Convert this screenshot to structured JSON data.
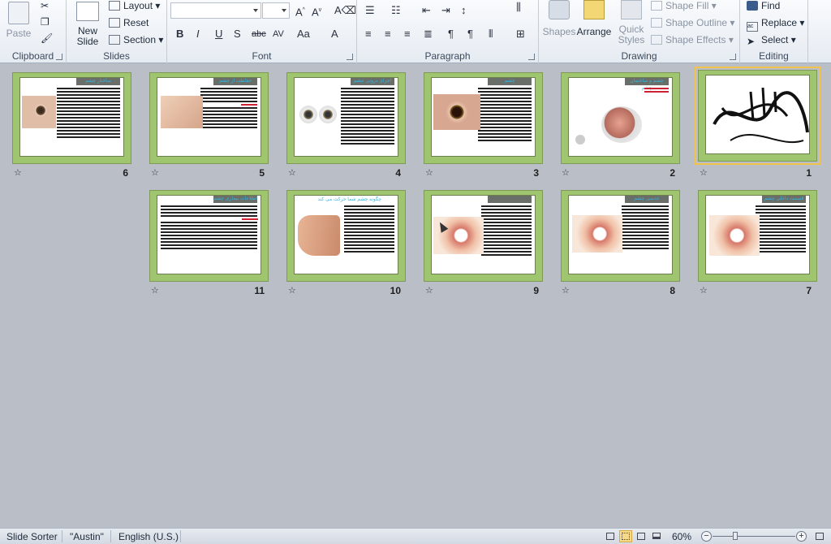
{
  "ribbon": {
    "clipboard": {
      "label": "Clipboard",
      "paste": "Paste"
    },
    "slides": {
      "label": "Slides",
      "new_slide": "New Slide",
      "layout": "Layout",
      "reset": "Reset",
      "section": "Section"
    },
    "font": {
      "label": "Font",
      "font_name": "",
      "font_size": ""
    },
    "paragraph": {
      "label": "Paragraph"
    },
    "drawing": {
      "label": "Drawing",
      "shapes": "Shapes",
      "arrange": "Arrange",
      "quick_styles": "Quick Styles",
      "shape_fill": "Shape Fill",
      "shape_outline": "Shape Outline",
      "shape_effects": "Shape Effects"
    },
    "editing": {
      "label": "Editing",
      "find": "Find",
      "replace": "Replace",
      "select": "Select"
    }
  },
  "slides": [
    {
      "number": "1",
      "title": "",
      "kind": "calligraphy",
      "selected": true
    },
    {
      "number": "2",
      "title": "چشم و ساختمان چشم",
      "kind": "diagram"
    },
    {
      "number": "3",
      "title": "چشم",
      "kind": "eye-photo"
    },
    {
      "number": "4",
      "title": "اجزای درونی چشم",
      "kind": "eyeballs"
    },
    {
      "number": "5",
      "title": "حفاظت از چشم",
      "kind": "face"
    },
    {
      "number": "6",
      "title": "ساختار چشم",
      "kind": "eye-photo"
    },
    {
      "number": "7",
      "title": "قسمت داخلی چشم",
      "kind": "eye-diagram"
    },
    {
      "number": "8",
      "title": "عدسی چشم",
      "kind": "eye-diagram"
    },
    {
      "number": "9",
      "title": "",
      "kind": "eye-diagram"
    },
    {
      "number": "10",
      "title": "چگونه چشم شما حرکت می کند",
      "kind": "profile"
    },
    {
      "number": "11",
      "title": "اطلاعات بیماری چشم",
      "kind": "text"
    }
  ],
  "status": {
    "view": "Slide Sorter",
    "theme": "\"Austin\"",
    "language": "English (U.S.)",
    "zoom": "60%"
  }
}
